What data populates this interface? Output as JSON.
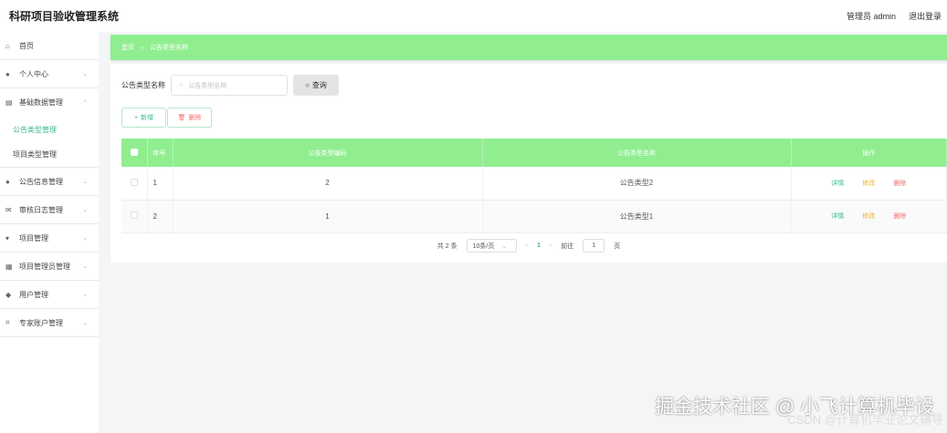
{
  "header": {
    "title": "科研项目验收管理系统",
    "user": "管理员 admin",
    "logout": "退出登录"
  },
  "sidebar": {
    "items": [
      {
        "label": "首页",
        "icon": "home-icon"
      },
      {
        "label": "个人中心",
        "icon": "user-icon"
      },
      {
        "label": "基础数据管理",
        "icon": "data-icon",
        "children": [
          {
            "label": "公告类型管理",
            "active": true
          },
          {
            "label": "项目类型管理"
          }
        ]
      },
      {
        "label": "公告信息管理",
        "icon": "user-icon"
      },
      {
        "label": "审核日志管理",
        "icon": "mail-icon"
      },
      {
        "label": "项目管理",
        "icon": "project-icon"
      },
      {
        "label": "项目管理员管理",
        "icon": "admin-icon"
      },
      {
        "label": "用户管理",
        "icon": "users-icon"
      },
      {
        "label": "专家账户管理",
        "icon": "expert-icon"
      }
    ]
  },
  "breadcrumb": {
    "home": "首页",
    "current": "公告类型名称"
  },
  "search": {
    "label": "公告类型名称",
    "placeholder": "公告类型名称",
    "button": "查询"
  },
  "actions": {
    "add": "新增",
    "delete": "删除"
  },
  "table": {
    "headers": [
      "序号",
      "公告类型编码",
      "公告类型名称",
      "操作"
    ],
    "rows": [
      {
        "index": "1",
        "code": "2",
        "name": "公告类型2"
      },
      {
        "index": "2",
        "code": "1",
        "name": "公告类型1"
      }
    ],
    "row_actions": {
      "detail": "详情",
      "edit": "修改",
      "delete": "删除"
    }
  },
  "pagination": {
    "total": "共 2 条",
    "page_size": "10条/页",
    "current": "1",
    "goto": "前往",
    "goto_value": "1",
    "page_suffix": "页"
  },
  "watermark": {
    "line1": "掘金技术社区 @ 小飞计算机毕设",
    "line2": "CSDN @计算机毕业论文辅导"
  }
}
